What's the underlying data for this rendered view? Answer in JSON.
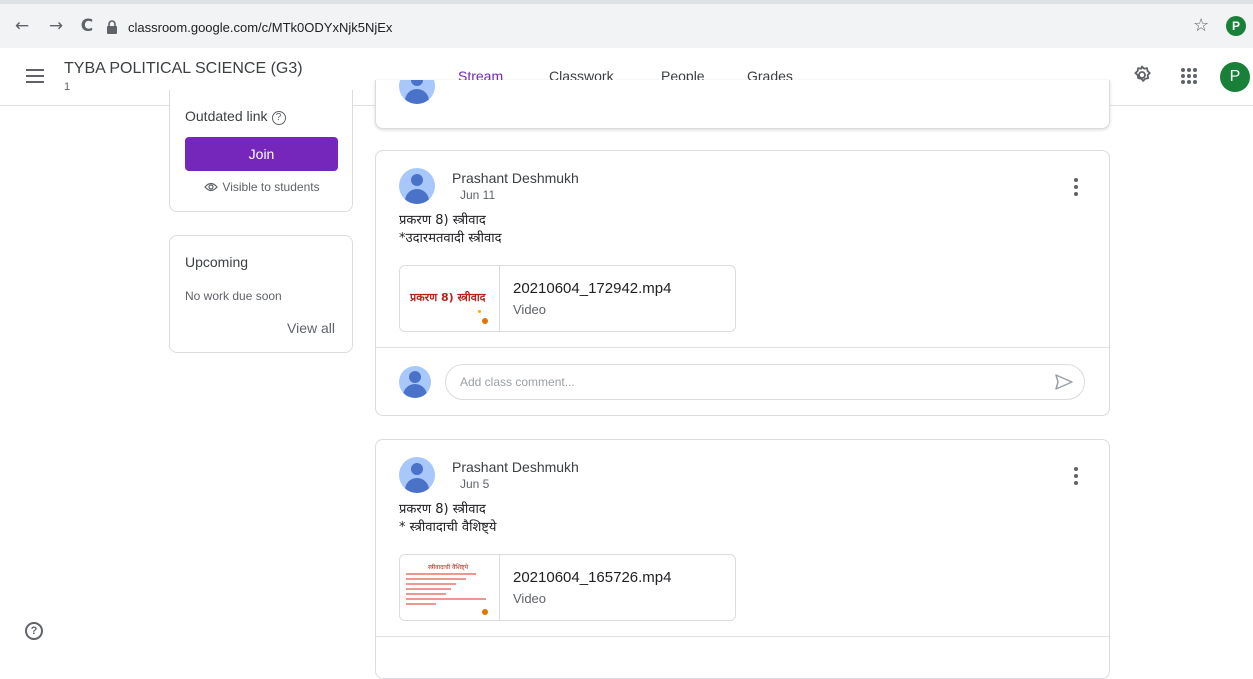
{
  "browser": {
    "url": "classroom.google.com/c/MTk0ODYxNjk5NjEx",
    "profile_initial": "P"
  },
  "header": {
    "class_title": "TYBA POLITICAL SCIENCE (G3)",
    "class_section": "1",
    "tabs": [
      {
        "label": "Stream",
        "active": true
      },
      {
        "label": "Classwork",
        "active": false
      },
      {
        "label": "People",
        "active": false
      },
      {
        "label": "Grades",
        "active": false
      }
    ],
    "avatar_initial": "P",
    "accent_color": "#7627bb"
  },
  "meet_card": {
    "outdated_label": "Outdated link",
    "join_label": "Join",
    "visibility_label": "Visible to students"
  },
  "upcoming": {
    "title": "Upcoming",
    "empty_text": "No work due soon",
    "view_all_label": "View all"
  },
  "posts": [
    {
      "author": "Prashant Deshmukh",
      "date": "Jun 11",
      "line1": "प्रकरण 8) स्त्रीवाद",
      "line2": "*उदारमतवादी स्त्रीवाद",
      "thumb_text": "प्रकरण 8) स्त्रीवाद",
      "attachment_name": "20210604_172942.mp4",
      "attachment_type": "Video",
      "comment_placeholder": "Add class comment..."
    },
    {
      "author": "Prashant Deshmukh",
      "date": "Jun 5",
      "line1": "प्रकरण 8) स्त्रीवाद",
      "line2": "* स्त्रीवादाची वैशिष्ट्ये",
      "thumb_text": "स्त्रीवादाची वैशिष्ट्ये",
      "attachment_name": "20210604_165726.mp4",
      "attachment_type": "Video"
    }
  ]
}
